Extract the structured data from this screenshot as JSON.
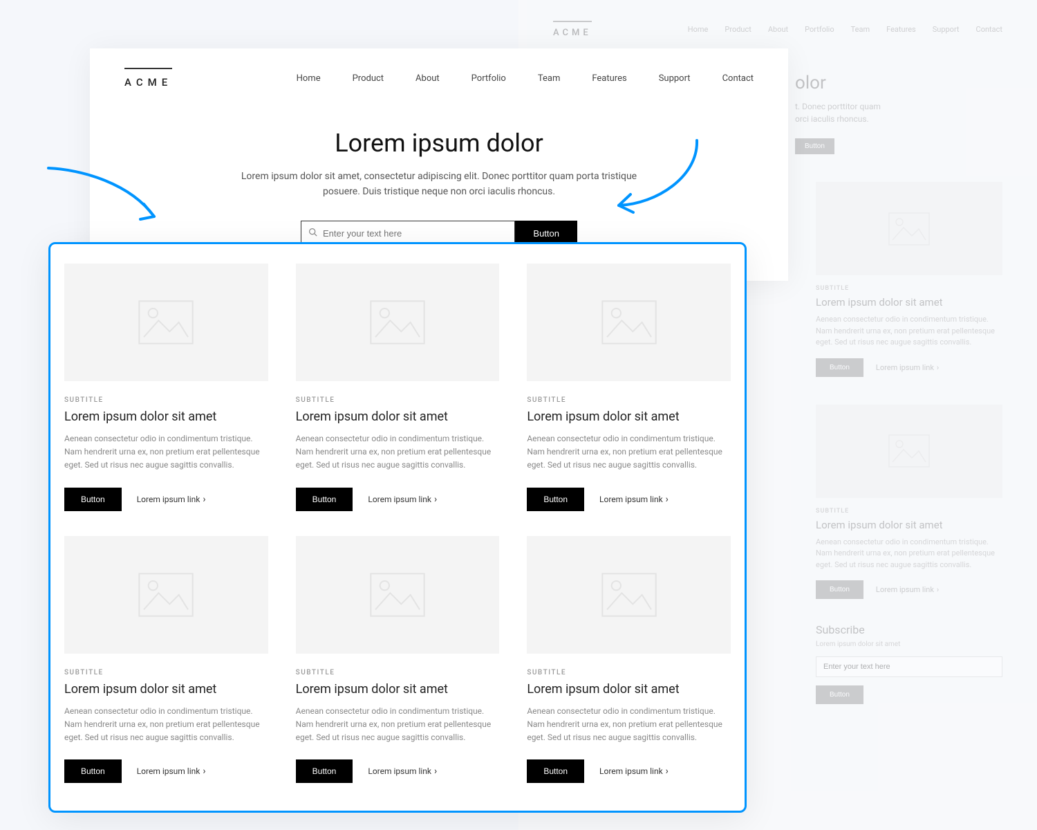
{
  "logo": "ACME",
  "nav": [
    "Home",
    "Product",
    "About",
    "Portfolio",
    "Team",
    "Features",
    "Support",
    "Contact"
  ],
  "hero": {
    "title": "Lorem ipsum dolor",
    "subtitle": "Lorem ipsum dolor sit amet, consectetur adipiscing elit. Donec porttitor quam porta tristique posuere. Duis tristique neque non orci iaculis rhoncus.",
    "search_placeholder": "Enter your text here",
    "button": "Button"
  },
  "bg": {
    "hero_title": "olor",
    "hero_sub": "t. Donec porttitor quam\norci iaculis rhoncus.",
    "hero_button": "Button",
    "cards": [
      {
        "subtitle": "SUBTITLE",
        "title": "Lorem ipsum dolor sit amet",
        "body": "Aenean consectetur odio in condimentum tristique. Nam hendrerit urna ex, non pretium erat pellentesque eget. Sed ut risus nec augue sagittis convallis.",
        "button": "Button",
        "link": "Lorem ipsum link"
      },
      {
        "subtitle": "SUBTITLE",
        "title": "Lorem ipsum dolor sit amet",
        "body": "Aenean consectetur odio in condimentum tristique. Nam hendrerit urna ex, non pretium erat pellentesque eget. Sed ut risus nec augue sagittis convallis.",
        "button": "Button",
        "link": "Lorem ipsum link"
      }
    ],
    "subscribe": {
      "title": "Subscribe",
      "desc": "Lorem ipsum dolor sit amet",
      "placeholder": "Enter your text here",
      "button": "Button"
    }
  },
  "cards": [
    {
      "subtitle": "SUBTITLE",
      "title": "Lorem ipsum dolor sit amet",
      "body": "Aenean consectetur odio in condimentum tristique. Nam hendrerit urna ex, non pretium erat pellentesque eget. Sed ut risus nec augue sagittis convallis.",
      "button": "Button",
      "link": "Lorem ipsum link"
    },
    {
      "subtitle": "SUBTITLE",
      "title": "Lorem ipsum dolor sit amet",
      "body": "Aenean consectetur odio in condimentum tristique. Nam hendrerit urna ex, non pretium erat pellentesque eget. Sed ut risus nec augue sagittis convallis.",
      "button": "Button",
      "link": "Lorem ipsum link"
    },
    {
      "subtitle": "SUBTITLE",
      "title": "Lorem ipsum dolor sit amet",
      "body": "Aenean consectetur odio in condimentum tristique. Nam hendrerit urna ex, non pretium erat pellentesque eget. Sed ut risus nec augue sagittis convallis.",
      "button": "Button",
      "link": "Lorem ipsum link"
    },
    {
      "subtitle": "SUBTITLE",
      "title": "Lorem ipsum dolor sit amet",
      "body": "Aenean consectetur odio in condimentum tristique. Nam hendrerit urna ex, non pretium erat pellentesque eget. Sed ut risus nec augue sagittis convallis.",
      "button": "Button",
      "link": "Lorem ipsum link"
    },
    {
      "subtitle": "SUBTITLE",
      "title": "Lorem ipsum dolor sit amet",
      "body": "Aenean consectetur odio in condimentum tristique. Nam hendrerit urna ex, non pretium erat pellentesque eget. Sed ut risus nec augue sagittis convallis.",
      "button": "Button",
      "link": "Lorem ipsum link"
    },
    {
      "subtitle": "SUBTITLE",
      "title": "Lorem ipsum dolor sit amet",
      "body": "Aenean consectetur odio in condimentum tristique. Nam hendrerit urna ex, non pretium erat pellentesque eget. Sed ut risus nec augue sagittis convallis.",
      "button": "Button",
      "link": "Lorem ipsum link"
    }
  ]
}
